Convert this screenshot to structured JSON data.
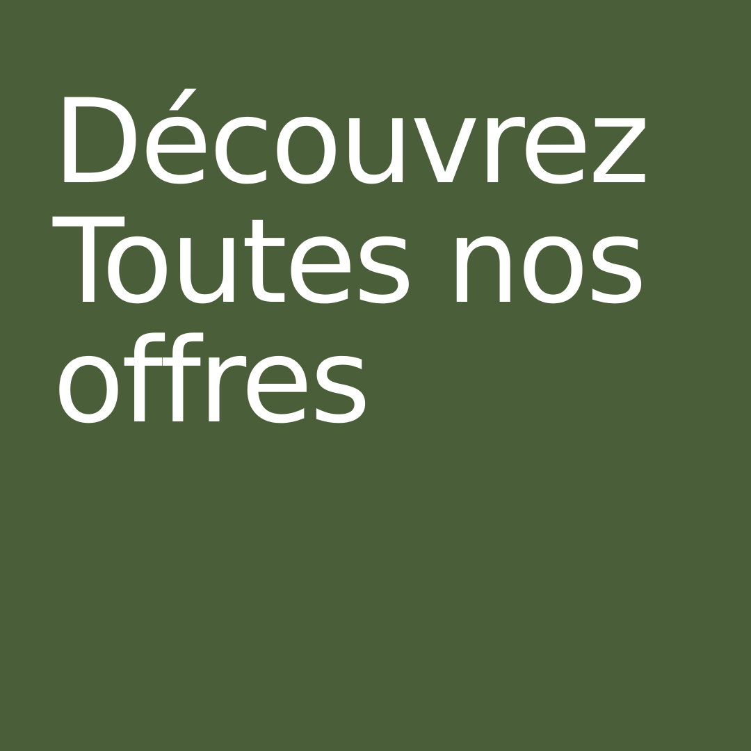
{
  "colors": {
    "background": "#4b5e3a",
    "text": "#ffffff"
  },
  "headline": {
    "line1": "Découvrez",
    "line2": "Toutes nos",
    "line3": "offres"
  }
}
